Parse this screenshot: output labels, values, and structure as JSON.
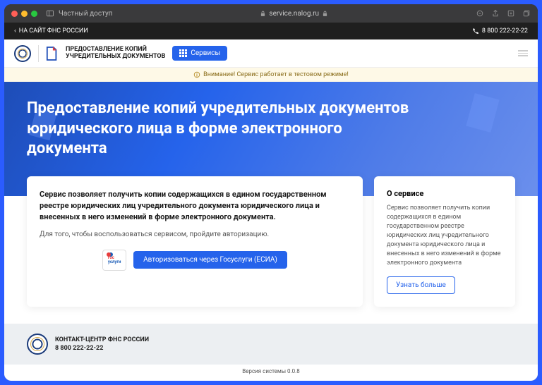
{
  "browser": {
    "tab_label": "Частный доступ",
    "url": "service.nalog.ru"
  },
  "topbar": {
    "back_link": "НА САЙТ ФНС РОССИИ",
    "phone": "8 800 222-22-22"
  },
  "header": {
    "title_line1": "ПРЕДОСТАВЛЕНИЕ КОПИЙ",
    "title_line2": "УЧРЕДИТЕЛЬНЫХ ДОКУМЕНТОВ",
    "services_button": "Сервисы"
  },
  "warning": {
    "text": "Внимание! Сервис работает в тестовом режиме!"
  },
  "hero": {
    "title": "Предоставление копий учредительных документов юридического лица в форме электронного документа"
  },
  "main_card": {
    "heading": "Сервис позволяет получить копии содержащихся в едином государственном реестре юридических лиц учредительного документа юридического лица и внесенных в него изменений в форме электронного документа.",
    "sub": "Для того, чтобы воспользоваться сервисом, пройдите авторизацию.",
    "gos_red": "гос",
    "gos_blue": "услуги",
    "auth_button": "Авторизоваться через Госуслуги (ЕСИА)"
  },
  "side_card": {
    "title": "О сервисе",
    "text": "Сервис позволяет получить копии содержащихся в едином государственном реестре юридических лиц учредительного документа юридического лица и внесенных в него изменений в форме электронного документа",
    "more_button": "Узнать больше"
  },
  "footer": {
    "contact_label": "КОНТАКТ-ЦЕНТР ФНС РОССИИ",
    "phone": "8 800 222-22-22"
  },
  "version": "Версия системы 0.0.8"
}
